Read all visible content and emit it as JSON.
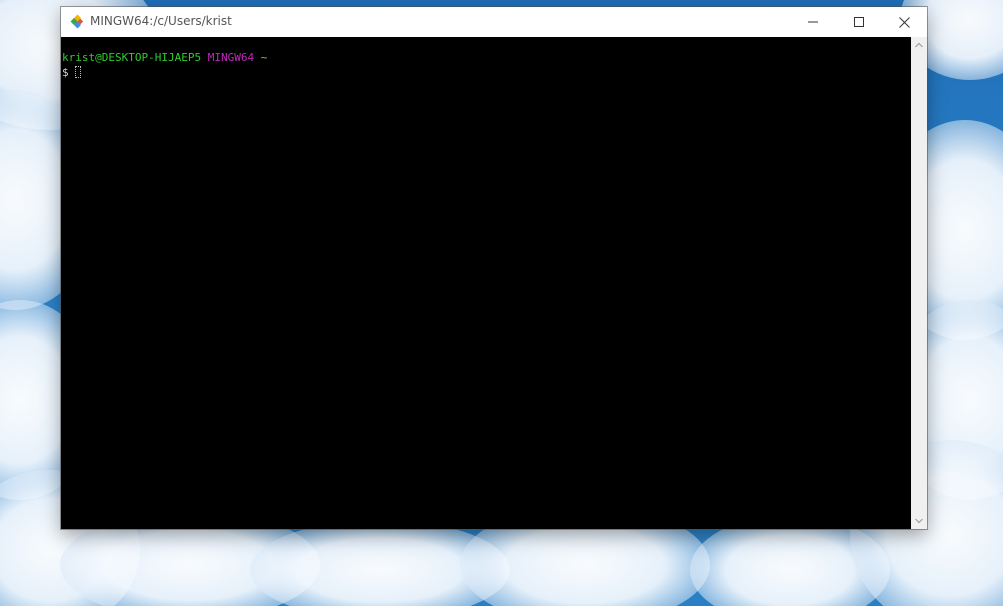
{
  "window": {
    "title": "MINGW64:/c/Users/krist",
    "icon": "git-icon",
    "controls": {
      "minimize": "minimize-icon",
      "maximize": "maximize-icon",
      "close": "close-icon"
    }
  },
  "terminal": {
    "prompt_user_host": "krist@DESKTOP-HIJAEP5",
    "prompt_system": "MINGW64",
    "prompt_path": "~",
    "prompt_symbol": "$",
    "input_value": ""
  },
  "colors": {
    "user_host": "#2ecc2e",
    "system": "#c028c0",
    "path": "#c4b02a",
    "terminal_bg": "#000000"
  }
}
